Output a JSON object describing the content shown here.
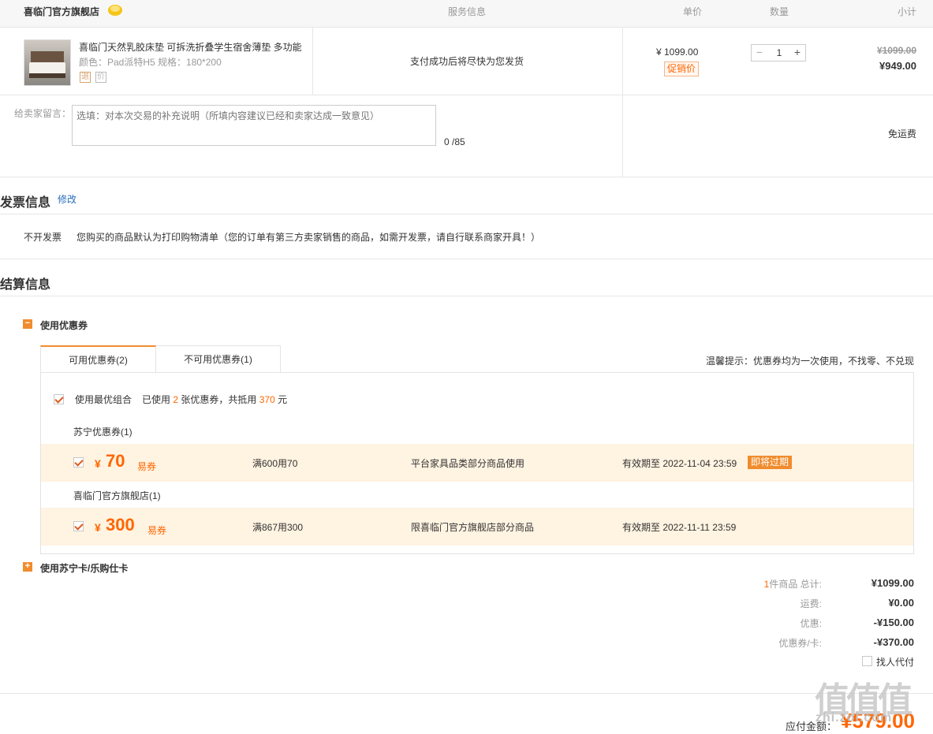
{
  "header": {
    "store_name": "喜临门官方旗舰店",
    "col_service": "服务信息",
    "col_unit_price": "单价",
    "col_quantity": "数量",
    "col_subtotal": "小计"
  },
  "product": {
    "title": "喜临门天然乳胶床垫 可拆洗折叠学生宿舍薄垫 多功能",
    "sku": "颜色：Pad派特H5   规格：180*200",
    "icon_return": "退",
    "icon_other": "价",
    "service_text": "支付成功后将尽快为您发货",
    "unit_price": "¥ 1099.00",
    "promo_tag": "促销价",
    "quantity": "1",
    "minus": "−",
    "plus": "+",
    "subtotal_original": "¥1099.00",
    "subtotal_now": "¥949.00"
  },
  "message": {
    "label": "给卖家留言：",
    "placeholder": "选填：对本次交易的补充说明（所填内容建议已经和卖家达成一致意见）",
    "count": "0 /85",
    "shipping": "免运费"
  },
  "invoice": {
    "title": "发票信息",
    "edit": "修改",
    "type": "不开发票",
    "desc": "您购买的商品默认为打印购物清单（您的订单有第三方卖家销售的商品，如需开发票，请自行联系商家开具！）"
  },
  "settlement": {
    "title": "结算信息",
    "coupon_section": "使用优惠券",
    "tab_available": "可用优惠券(2)",
    "tab_unavailable": "不可用优惠券(1)",
    "tip": "温馨提示：优惠券均为一次使用，不找零、不兑现",
    "best_combo": "使用最优组合",
    "used_prefix": "已使用",
    "used_count": "2",
    "used_mid": "张优惠券，共抵用",
    "used_amount": "370",
    "used_suffix": "元",
    "groups": [
      {
        "label": "苏宁优惠券(1)",
        "currency": "¥",
        "amount": "70",
        "kind": "易券",
        "condition": "满600用70",
        "scope": "平台家具品类部分商品使用",
        "expiry": "有效期至 2022-11-04 23:59",
        "tag": "即将过期"
      },
      {
        "label": "喜临门官方旗舰店(1)",
        "currency": "¥",
        "amount": "300",
        "kind": "易券",
        "condition": "满867用300",
        "scope": "限喜临门官方旗舰店部分商品",
        "expiry": "有效期至 2022-11-11 23:59",
        "tag": ""
      }
    ],
    "card_section": "使用苏宁卡/乐购仕卡"
  },
  "totals": {
    "count": "1",
    "count_label": "件商品 总计:",
    "total": "¥1099.00",
    "shipping_label": "运费:",
    "shipping": "¥0.00",
    "discount_label": "优惠:",
    "discount": "-¥150.00",
    "coupon_label": "优惠券/卡:",
    "coupon": "-¥370.00",
    "proxy_label": "找人代付",
    "pay_label": "应付金额：",
    "pay_amount": "¥579.00"
  },
  "watermark": {
    "main": "值值值",
    "sub": "zhi.zol.com"
  },
  "colors": {
    "accent": "#f60",
    "coupon_bg": "#fff3e1",
    "tab_accent": "#f08c2e"
  }
}
